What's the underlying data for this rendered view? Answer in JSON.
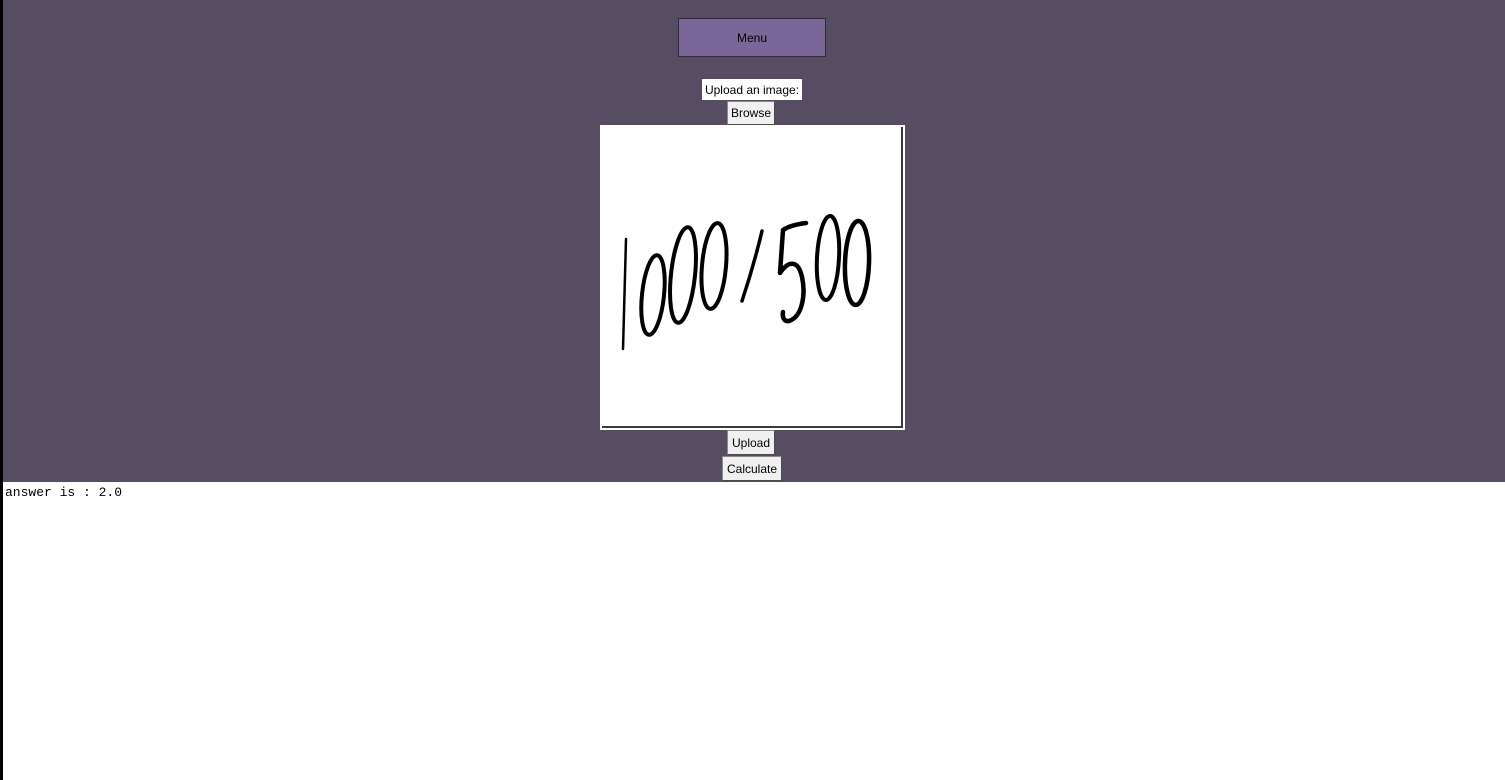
{
  "toolbar": {
    "menu_label": "Menu"
  },
  "upload": {
    "label": "Upload an image:",
    "browse_label": "Browse",
    "upload_label": "Upload",
    "calculate_label": "Calculate"
  },
  "image": {
    "handwritten_text": "1000/500"
  },
  "output": {
    "text": "answer is : 2.0"
  },
  "colors": {
    "background": "#564d63",
    "menu_button": "#7b6699",
    "output_background": "#ffffff"
  }
}
